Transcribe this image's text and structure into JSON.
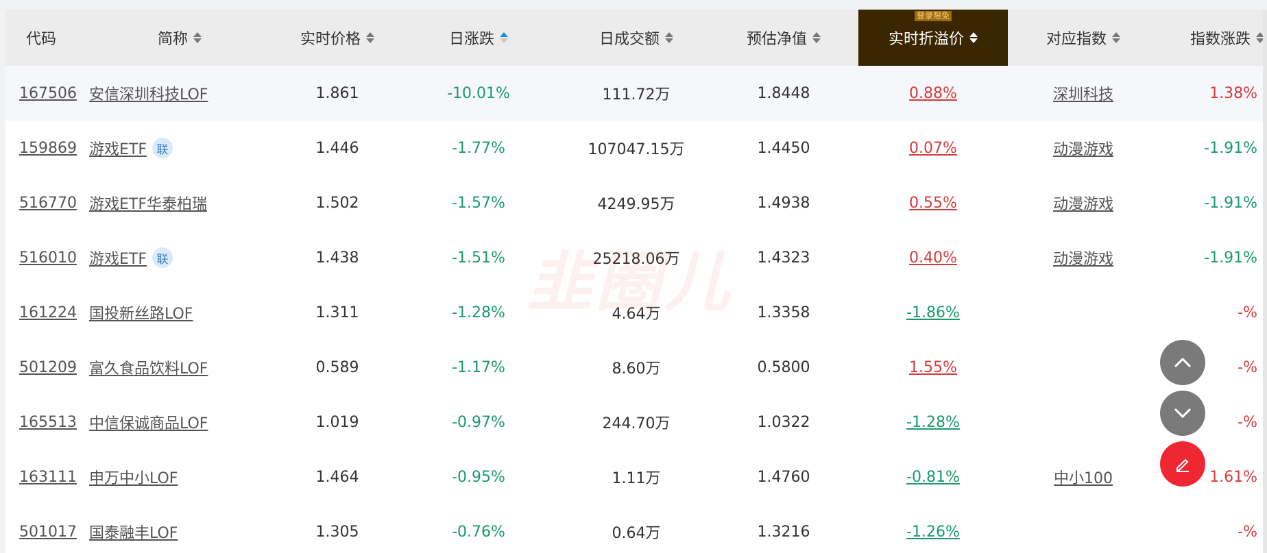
{
  "table": {
    "headers": {
      "code": "代码",
      "name": "简称",
      "price": "实时价格",
      "change": "日涨跌",
      "volume": "日成交额",
      "nav": "预估净值",
      "premium": "实时折溢价",
      "index": "对应指数",
      "index_change": "指数涨跌"
    },
    "login_tag": "登录限免",
    "rows": [
      {
        "code": "167506",
        "name": "安信深圳科技LOF",
        "badge": "",
        "price": "1.861",
        "change": "-10.01%",
        "volume": "111.72万",
        "nav": "1.8448",
        "premium": "0.88%",
        "premium_dir": "up",
        "index": "深圳科技",
        "index_change": "1.38%",
        "index_dir": "up"
      },
      {
        "code": "159869",
        "name": "游戏ETF",
        "badge": "联",
        "price": "1.446",
        "change": "-1.77%",
        "volume": "107047.15万",
        "nav": "1.4450",
        "premium": "0.07%",
        "premium_dir": "up",
        "index": "动漫游戏",
        "index_change": "-1.91%",
        "index_dir": "down"
      },
      {
        "code": "516770",
        "name": "游戏ETF华泰柏瑞",
        "badge": "",
        "price": "1.502",
        "change": "-1.57%",
        "volume": "4249.95万",
        "nav": "1.4938",
        "premium": "0.55%",
        "premium_dir": "up",
        "index": "动漫游戏",
        "index_change": "-1.91%",
        "index_dir": "down"
      },
      {
        "code": "516010",
        "name": "游戏ETF",
        "badge": "联",
        "price": "1.438",
        "change": "-1.51%",
        "volume": "25218.06万",
        "nav": "1.4323",
        "premium": "0.40%",
        "premium_dir": "up",
        "index": "动漫游戏",
        "index_change": "-1.91%",
        "index_dir": "down"
      },
      {
        "code": "161224",
        "name": "国投新丝路LOF",
        "badge": "",
        "price": "1.311",
        "change": "-1.28%",
        "volume": "4.64万",
        "nav": "1.3358",
        "premium": "-1.86%",
        "premium_dir": "down",
        "index": "",
        "index_change": "-%",
        "index_dir": "up"
      },
      {
        "code": "501209",
        "name": "富久食品饮料LOF",
        "badge": "",
        "price": "0.589",
        "change": "-1.17%",
        "volume": "8.60万",
        "nav": "0.5800",
        "premium": "1.55%",
        "premium_dir": "up",
        "index": "",
        "index_change": "-%",
        "index_dir": "up"
      },
      {
        "code": "165513",
        "name": "中信保诚商品LOF",
        "badge": "",
        "price": "1.019",
        "change": "-0.97%",
        "volume": "244.70万",
        "nav": "1.0322",
        "premium": "-1.28%",
        "premium_dir": "down",
        "index": "",
        "index_change": "-%",
        "index_dir": "up"
      },
      {
        "code": "163111",
        "name": "申万中小LOF",
        "badge": "",
        "price": "1.464",
        "change": "-0.95%",
        "volume": "1.11万",
        "nav": "1.4760",
        "premium": "-0.81%",
        "premium_dir": "down",
        "index": "中小100",
        "index_change": "1.61%",
        "index_dir": "up"
      },
      {
        "code": "501017",
        "name": "国泰融丰LOF",
        "badge": "",
        "price": "1.305",
        "change": "-0.76%",
        "volume": "0.64万",
        "nav": "1.3216",
        "premium": "-1.26%",
        "premium_dir": "down",
        "index": "",
        "index_change": "-%",
        "index_dir": "up"
      }
    ]
  },
  "floating_buttons": {
    "scroll_up_icon": "chevron-up-icon",
    "scroll_down_icon": "chevron-down-icon",
    "edit_icon": "pencil-icon"
  },
  "colors": {
    "up": "#d83a3a",
    "down": "#1a9a6a",
    "highlight_header": "#3a2600",
    "highlight_column": "#fffaf1"
  }
}
